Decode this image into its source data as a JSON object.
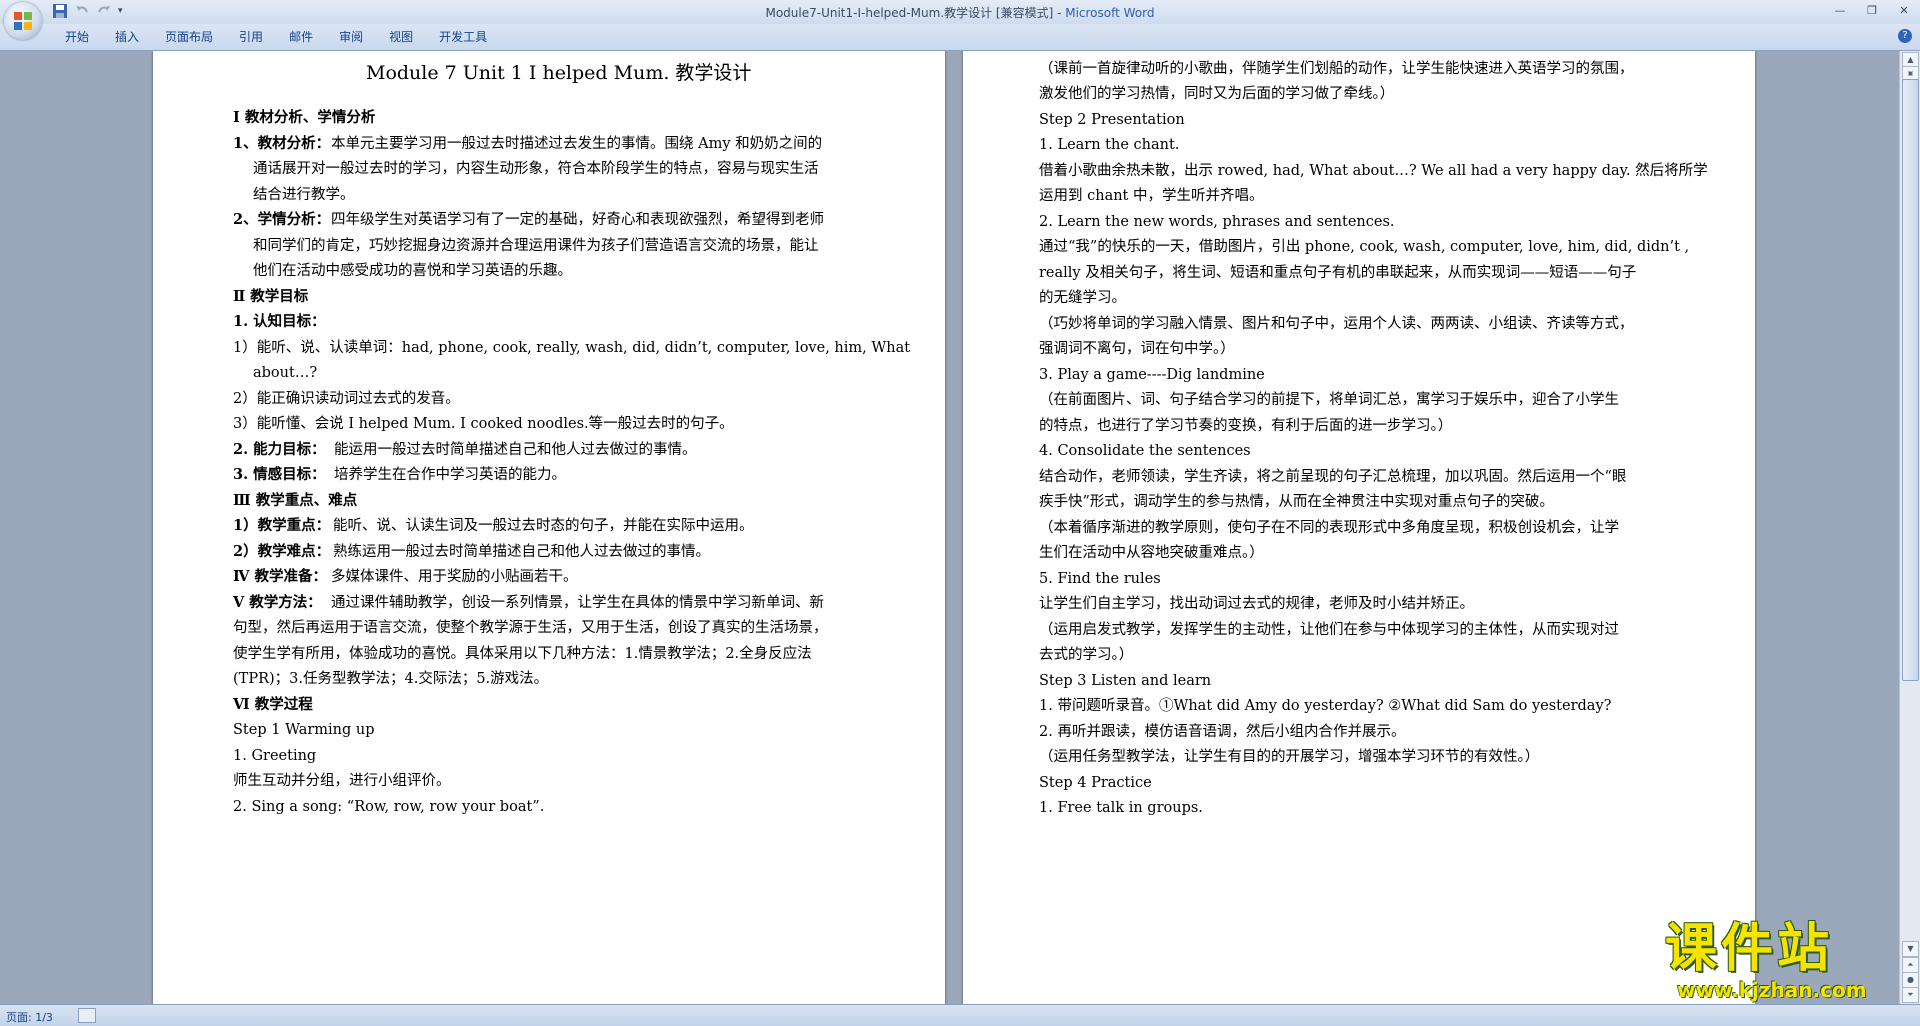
{
  "window": {
    "document_name": "Module7-Unit1-I-helped-Mum.教学设计 [兼容模式] - ",
    "app_name": "Microsoft Word"
  },
  "ribbon": {
    "tabs": [
      "开始",
      "插入",
      "页面布局",
      "引用",
      "邮件",
      "审阅",
      "视图",
      "开发工具"
    ]
  },
  "status": {
    "page": "页面: 1/3"
  },
  "watermark": {
    "text": "课件站",
    "url": "www.kjzhan.com"
  },
  "page1": {
    "lines": [
      "Module 7 Unit 1 I helped Mum.  教学设计",
      "Ⅰ 教材分析、学情分析",
      "1、教材分析：",
      "本单元主要学习用一般过去时描述过去发生的事情。围绕 Amy 和奶奶之间的",
      "通话展开对一般过去时的学习，内容生动形象，符合本阶段学生的特点，容易与现实生活",
      "结合进行教学。",
      "2、学情分析：",
      "四年级学生对英语学习有了一定的基础，好奇心和表现欲强烈，希望得到老师",
      "和同学们的肯定，巧妙挖掘身边资源并合理运用课件为孩子们营造语言交流的场景，能让",
      "他们在活动中感受成功的喜悦和学习英语的乐趣。",
      "Ⅱ 教学目标",
      "1. 认知目标：",
      "1）能听、说、认读单词：had, phone, cook, really, wash, did, didn’t, computer, love, him, What",
      "about…?",
      "2）能正确识读动词过去式的发音。",
      "3）能听懂、会说 I helped Mum. I cooked noodles.等一般过去时的句子。",
      "2. 能力目标：",
      "能运用一般过去时简单描述自己和他人过去做过的事情。",
      "3. 情感目标：",
      "培养学生在合作中学习英语的能力。",
      "Ⅲ 教学重点、难点",
      "1）教学重点：",
      "能听、说、认读生词及一般过去时态的句子，并能在实际中运用。",
      "2）教学难点：",
      "熟练运用一般过去时简单描述自己和他人过去做过的事情。",
      "Ⅳ 教学准备：",
      "多媒体课件、用于奖励的小贴画若干。",
      "Ⅴ 教学方法：",
      "通过课件辅助教学，创设一系列情景，让学生在具体的情景中学习新单词、新",
      "句型，然后再运用于语言交流，使整个教学源于生活，又用于生活，创设了真实的生活场景，",
      "使学生学有所用，体验成功的喜悦。具体采用以下几种方法：1.情景教学法；2.全身反应法",
      "(TPR)；3.任务型教学法；4.交际法；5.游戏法。",
      "Ⅵ 教学过程",
      "Step 1 Warming up",
      "1.   Greeting",
      "师生互动并分组，进行小组评价。",
      "2.   Sing a song: “Row, row, row your boat”."
    ]
  },
  "page2": {
    "lines": [
      "（课前一首旋律动听的小歌曲，伴随学生们划船的动作，让学生能快速进入英语学习的氛围，",
      "激发他们的学习热情，同时又为后面的学习做了牵线。）",
      "Step 2 Presentation",
      "1.   Learn the chant.",
      "借着小歌曲余热未散，出示 rowed, had, What about…? We all had a very happy day.  然后将所学",
      "运用到 chant 中，学生听并齐唱。",
      "2.   Learn the new words, phrases and sentences.",
      "通过“我”的快乐的一天，借助图片，引出 phone, cook, wash, computer, love, him, did, didn’t ,",
      "really 及相关句子，将生词、短语和重点句子有机的串联起来，从而实现词——短语——句子",
      "的无缝学习。",
      "（巧妙将单词的学习融入情景、图片和句子中，运用个人读、两两读、小组读、齐读等方式，",
      "强调词不离句，词在句中学。）",
      "3.   Play a game----Dig landmine",
      "（在前面图片、词、句子结合学习的前提下，将单词汇总，寓学习于娱乐中，迎合了小学生",
      "的特点，也进行了学习节奏的变换，有利于后面的进一步学习。）",
      "4.   Consolidate the sentences",
      "结合动作，老师领读，学生齐读，将之前呈现的句子汇总梳理，加以巩固。然后运用一个“眼",
      "疾手快”形式，调动学生的参与热情，从而在全神贯注中实现对重点句子的突破。",
      "（本着循序渐进的教学原则，使句子在不同的表现形式中多角度呈现，积极创设机会，让学",
      "生们在活动中从容地突破重难点。）",
      "5.   Find the rules",
      "让学生们自主学习，找出动词过去式的规律，老师及时小结并矫正。",
      "（运用启发式教学，发挥学生的主动性，让他们在参与中体现学习的主体性，从而实现对过",
      "去式的学习。）",
      "Step 3 Listen and learn",
      "1.   带问题听录音。①What did Amy do yesterday?  ②What did Sam do yesterday?",
      "2.   再听并跟读，模仿语音语调，然后小组内合作并展示。",
      "（运用任务型教学法，让学生有目的的开展学习，增强本学习环节的有效性。）",
      "Step 4 Practice",
      "1.   Free talk in groups."
    ]
  }
}
